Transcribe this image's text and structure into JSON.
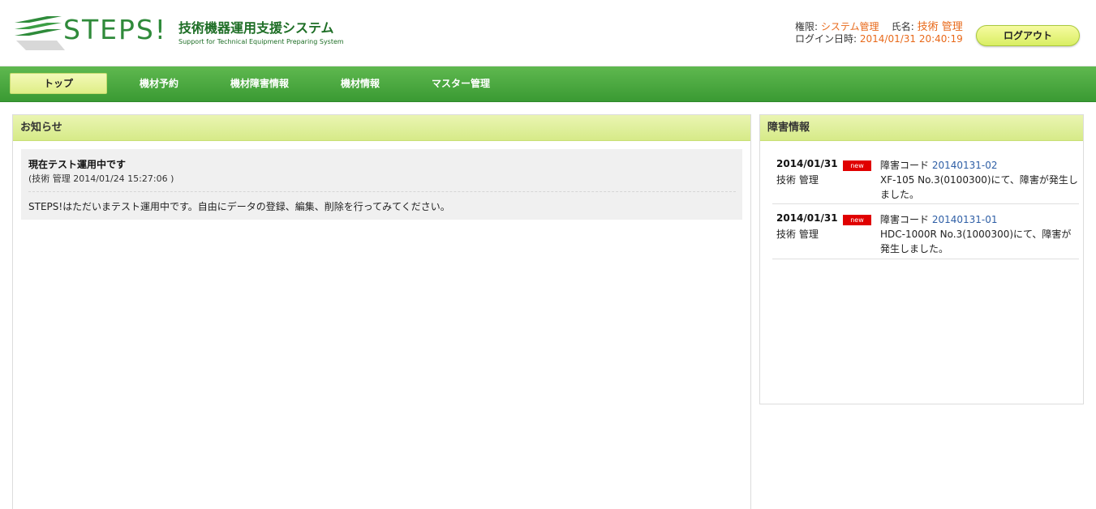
{
  "header": {
    "logo_text": "STEPS!",
    "subtitle": "技術機器運用支援システム",
    "subtitle_en": "Support for Technical Equipment Preparing System",
    "role_label": "権限:",
    "role_value": "システム管理",
    "name_label": "氏名:",
    "name_value": "技術 管理",
    "login_label": "ログイン日時:",
    "login_value": "2014/01/31 20:40:19",
    "logout_label": "ログアウト"
  },
  "nav": {
    "items": [
      {
        "label": "トップ"
      },
      {
        "label": "機材予約"
      },
      {
        "label": "機材障害情報"
      },
      {
        "label": "機材情報"
      },
      {
        "label": "マスター管理"
      }
    ]
  },
  "news": {
    "heading": "お知らせ",
    "items": [
      {
        "title": "現在テスト運用中です",
        "meta": "(技術 管理 2014/01/24 15:27:06 )",
        "body": "STEPS!はただいまテスト運用中です。自由にデータの登録、編集、削除を行ってみてください。"
      }
    ]
  },
  "faults": {
    "heading": "障害情報",
    "badge": "new",
    "code_label": "障害コード",
    "items": [
      {
        "date": "2014/01/31",
        "user": "技術 管理",
        "code": "20140131-02",
        "desc": "XF-105 No.3(0100300)にて、障害が発生しました。"
      },
      {
        "date": "2014/01/31",
        "user": "技術 管理",
        "code": "20140131-01",
        "desc": "HDC-1000R No.3(1000300)にて、障害が発生しました。"
      }
    ]
  },
  "colors": {
    "brand_green": "#3a9a33",
    "accent_orange": "#e8691a",
    "link_blue": "#2f5fa6",
    "badge_red": "#e00000",
    "panel_head": "#d6ea88"
  }
}
